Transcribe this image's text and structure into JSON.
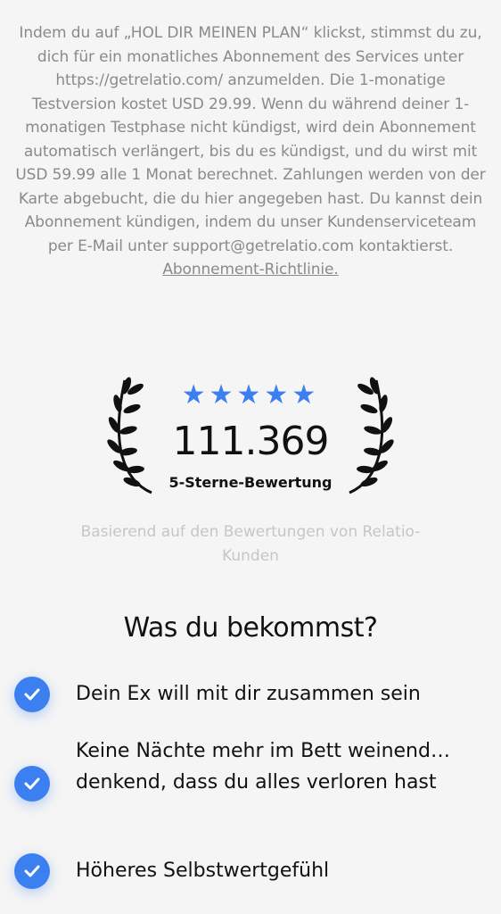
{
  "terms": {
    "text": "Indem du auf „HOL DIR MEINEN PLAN“ klickst, stimmst du zu, dich für ein monatliches Abonnement des Services unter https://getrelatio.com/ anzumelden. Die 1-monatige Testversion kostet USD 29.99. Wenn du während deiner 1-monatigen Testphase nicht kündigst, wird dein Abonnement automatisch verlängert, bis du es kündigst, und du wirst mit USD 59.99 alle 1 Monat berechnet. Zahlungen werden von der Karte abgebucht, die du hier angegeben hast. Du kannst dein Abonnement kündigen, indem du unser Kundenserviceteam per E-Mail unter support@getrelatio.com kontaktierst.",
    "link_label": "Abonnement-Richtlinie."
  },
  "rating": {
    "stars": "★★★★★",
    "star_count": 5,
    "count": "111.369",
    "label": "5-Sterne-Bewertung",
    "star_color": "#3b7ff0"
  },
  "based_on": "Basierend auf den Bewertungen von Relatio-Kunden",
  "section_title": "Was du bekommst?",
  "benefits": [
    {
      "text": "Dein Ex will mit dir zusammen sein",
      "icon": "check-icon"
    },
    {
      "text": "Keine Nächte mehr im Bett weinend… denkend, dass du alles verloren hast",
      "icon": "check-icon"
    },
    {
      "text": "Höheres Selbstwertgefühl",
      "icon": "check-icon"
    }
  ],
  "colors": {
    "accent": "#3b7ff0",
    "muted_text": "#8a8a8a",
    "light_text": "#c6c6c6",
    "background": "#f5f5f5"
  }
}
